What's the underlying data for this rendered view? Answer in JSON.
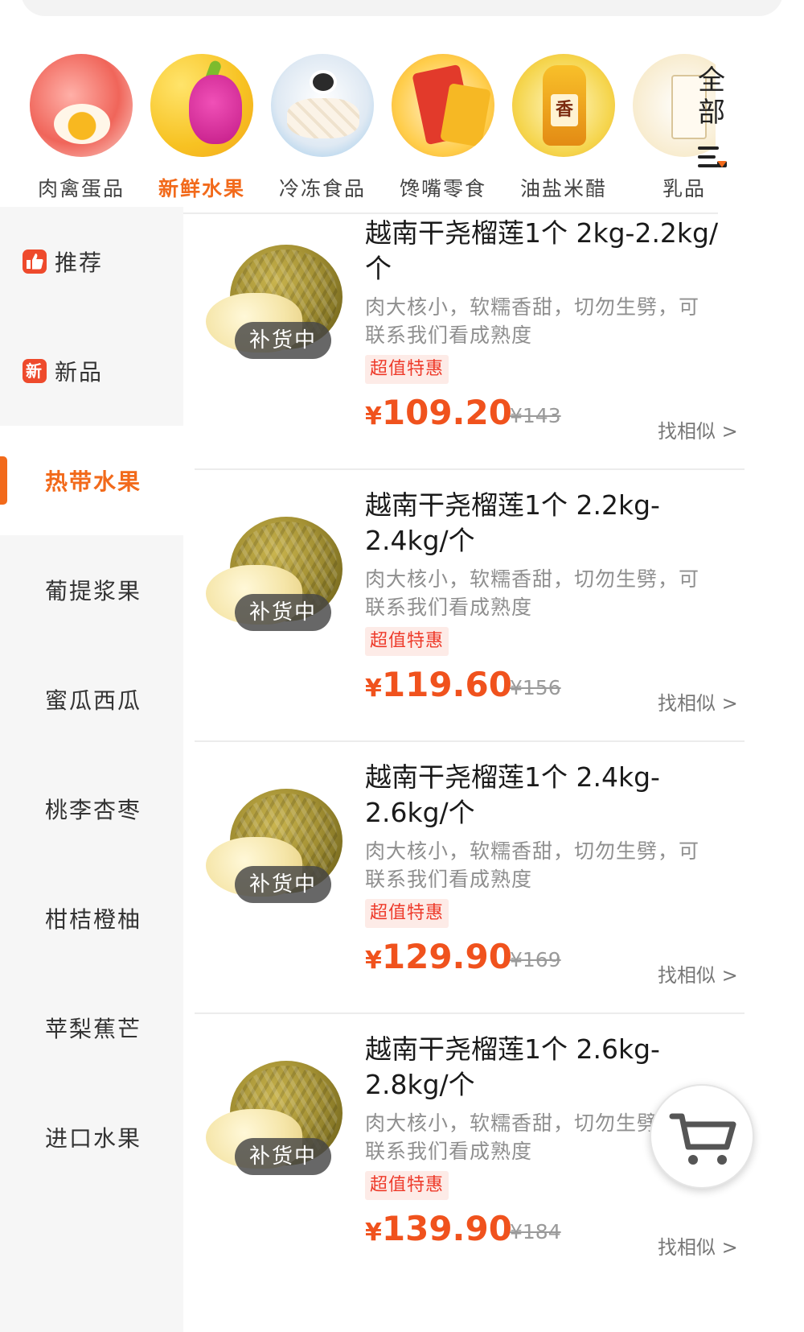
{
  "categories": [
    {
      "label": "肉禽蛋品",
      "icon": "meat-egg-icon",
      "active": false
    },
    {
      "label": "新鲜水果",
      "icon": "fresh-fruit-icon",
      "active": true
    },
    {
      "label": "冷冻食品",
      "icon": "frozen-food-icon",
      "active": false
    },
    {
      "label": "馋嘴零食",
      "icon": "snack-icon",
      "active": false
    },
    {
      "label": "油盐米醋",
      "icon": "oil-condiment-icon",
      "active": false
    },
    {
      "label": "乳品",
      "icon": "dairy-icon",
      "active": false
    }
  ],
  "all_button": {
    "label": "全部"
  },
  "oil_tag": "香",
  "sidebar": {
    "items": [
      {
        "label": "推荐",
        "icon_text": "",
        "active": false
      },
      {
        "label": "新品",
        "icon_text": "新",
        "active": false
      },
      {
        "label": "热带水果",
        "active": true
      },
      {
        "label": "葡提浆果",
        "active": false
      },
      {
        "label": "蜜瓜西瓜",
        "active": false
      },
      {
        "label": "桃李杏枣",
        "active": false
      },
      {
        "label": "柑桔橙柚",
        "active": false
      },
      {
        "label": "苹梨蕉芒",
        "active": false
      },
      {
        "label": "进口水果",
        "active": false
      }
    ]
  },
  "products": [
    {
      "title": "越南干尧榴莲1个 2kg-2.2kg/个",
      "description": "肉大核小，软糯香甜，切勿生劈，可联系我们看成熟度",
      "status": "补货中",
      "badge": "超值特惠",
      "currency": "¥",
      "price": "109.20",
      "original_price": "¥143",
      "similar": "找相似 >"
    },
    {
      "title": "越南干尧榴莲1个 2.2kg-2.4kg/个",
      "description": "肉大核小，软糯香甜，切勿生劈，可联系我们看成熟度",
      "status": "补货中",
      "badge": "超值特惠",
      "currency": "¥",
      "price": "119.60",
      "original_price": "¥156",
      "similar": "找相似 >"
    },
    {
      "title": "越南干尧榴莲1个 2.4kg-2.6kg/个",
      "description": "肉大核小，软糯香甜，切勿生劈，可联系我们看成熟度",
      "status": "补货中",
      "badge": "超值特惠",
      "currency": "¥",
      "price": "129.90",
      "original_price": "¥169",
      "similar": "找相似 >"
    },
    {
      "title": "越南干尧榴莲1个 2.6kg-2.8kg/个",
      "description": "肉大核小，软糯香甜，切勿生劈，可联系我们看成熟度",
      "status": "补货中",
      "badge": "超值特惠",
      "currency": "¥",
      "price": "139.90",
      "original_price": "¥184",
      "similar": "找相似 >"
    }
  ],
  "colors": {
    "accent": "#f26a1b",
    "price": "#f0521d",
    "badge_text": "#ee3a2a",
    "badge_bg": "#fdebe7",
    "sidebar_bg": "#f6f6f6"
  },
  "cart_icon": "shopping-cart-icon"
}
